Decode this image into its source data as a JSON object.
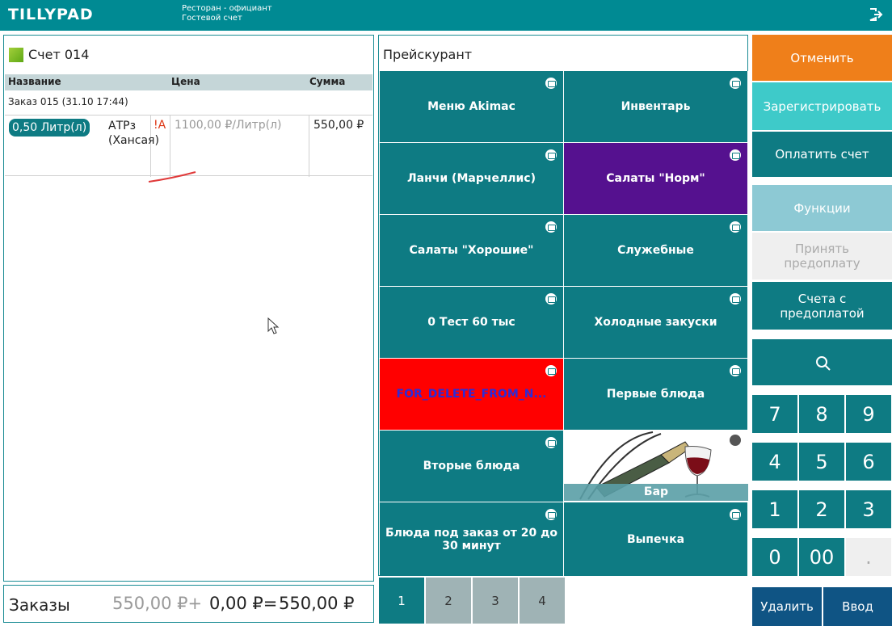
{
  "topbar": {
    "logo": "TILLYPAD",
    "role": "Ресторан - официант",
    "screen": "Гостевой счет"
  },
  "bill": {
    "title": "Счет 014",
    "columns": [
      "Название",
      "Цена",
      "Сумма"
    ],
    "order_line": "Заказ 015 (31.10 17:44)",
    "items": [
      {
        "qty": "0,50 Литр(л)",
        "name": "АТРз (Хансая)",
        "flag": "!A",
        "price": "1100,00 ₽/Литр(л)",
        "sum": "550,00 ₽"
      }
    ]
  },
  "totals": {
    "label": "Заказы",
    "ordered": "550,00 ₽+",
    "extra": "0,00 ₽=",
    "total": "550,00 ₽"
  },
  "price_list": {
    "title": "Прейскурант",
    "tiles": [
      {
        "label": "Меню Akimac",
        "style": "default"
      },
      {
        "label": "Инвентарь",
        "style": "default"
      },
      {
        "label": "Ланчи (Марчеллис)",
        "style": "default"
      },
      {
        "label": "Салаты \"Норм\"",
        "style": "purple"
      },
      {
        "label": "Салаты \"Хорошие\"",
        "style": "default"
      },
      {
        "label": "Служебные",
        "style": "default"
      },
      {
        "label": "0 Тест 60 тыс",
        "style": "default"
      },
      {
        "label": "Холодные закуски",
        "style": "default"
      },
      {
        "label": "FOR_DELETE_FROM_N...",
        "style": "red"
      },
      {
        "label": "Первые блюда",
        "style": "default"
      },
      {
        "label": "Вторые блюда",
        "style": "default"
      },
      {
        "label": "Бар",
        "style": "image"
      },
      {
        "label": "Блюда под заказ от 20 до 30 минут",
        "style": "default"
      },
      {
        "label": "Выпечка",
        "style": "default"
      }
    ],
    "pages": [
      "1",
      "2",
      "3",
      "4"
    ]
  },
  "actions": {
    "cancel": "Отменить",
    "register": "Зарегистрировать",
    "pay": "Оплатить счет",
    "functions": "Функции",
    "prepay": "Принять предоплату",
    "prepaid_bills": "Счета с предоплатой"
  },
  "keypad": [
    "7",
    "8",
    "9",
    "4",
    "5",
    "6",
    "1",
    "2",
    "3",
    "0",
    "00",
    "."
  ],
  "bottom": {
    "delete": "Удалить",
    "enter": "Ввод"
  },
  "colors": {
    "brand": "#008a93",
    "tile": "#0e7b83",
    "cancel": "#ef7f1a",
    "register": "#3ecac9",
    "functions": "#8dc9d4",
    "purple": "#55118f",
    "red": "#ff0000",
    "bottom": "#0f5484"
  }
}
